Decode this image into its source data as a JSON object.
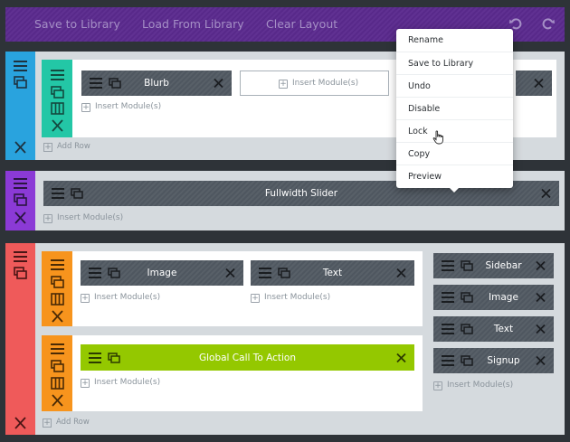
{
  "colors": {
    "toolbar": "#5b2a8e",
    "section_standard": "#29a3de",
    "section_fullwidth": "#8b3ad6",
    "section_specialty": "#ef5a5a",
    "row_standard": "#23c7a6",
    "row_specialty": "#f7941d",
    "module_default": "#525a63",
    "module_global": "#94c800"
  },
  "toolbar": {
    "save_label": "Save to Library",
    "load_label": "Load From Library",
    "clear_label": "Clear Layout",
    "undo_icon": "undo-icon",
    "redo_icon": "redo-icon"
  },
  "section1": {
    "modules": {
      "blurb": "Blurb"
    },
    "insert_module": "Insert Module(s)",
    "insert_module_col2": "Insert Module(s)",
    "add_row": "Add Row"
  },
  "section2": {
    "module": "Fullwidth Slider",
    "insert_module": "Insert Module(s)"
  },
  "section3": {
    "row1": {
      "col1_module": "Image",
      "col2_module": "Text",
      "insert_module_col1": "Insert Module(s)",
      "insert_module_col2": "Insert Module(s)"
    },
    "row2": {
      "module": "Global Call To Action",
      "insert_module": "Insert Module(s)"
    },
    "sidebar_modules": [
      "Sidebar",
      "Image",
      "Text",
      "Signup"
    ],
    "sidebar_insert": "Insert Module(s)",
    "add_row": "Add Row"
  },
  "context_menu": {
    "items": [
      "Rename",
      "Save to Library",
      "Undo",
      "Disable",
      "Lock",
      "Copy",
      "Preview"
    ],
    "hovered": "Lock"
  }
}
